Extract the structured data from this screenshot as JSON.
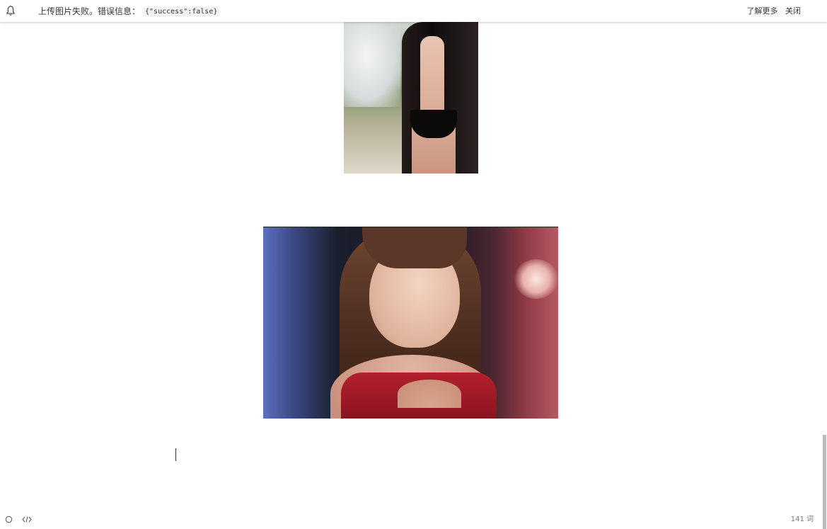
{
  "notification": {
    "icon": "bell-icon",
    "message": "上传图片失败。错误信息：",
    "error_code": "{\"success\":false}",
    "learn_more": "了解更多",
    "close": "关闭"
  },
  "editor": {
    "images": [
      {
        "name": "embedded-image-1",
        "description_icon": "photo"
      },
      {
        "name": "embedded-image-2",
        "description_icon": "photo"
      }
    ]
  },
  "footer": {
    "left_icons": [
      "circle-icon",
      "code-icon"
    ],
    "word_count": "141 词"
  }
}
